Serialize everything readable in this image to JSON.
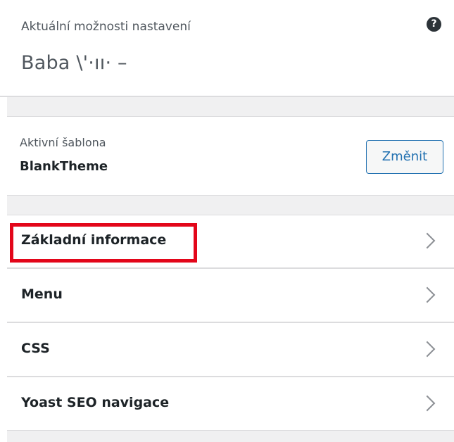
{
  "header": {
    "sublabel": "Aktuální možnosti nastavení",
    "site_title": "Baba \\'·ıı· –",
    "help_icon": "help-icon",
    "help_glyph": "?"
  },
  "theme": {
    "label": "Aktivní šablona",
    "name": "BlankTheme",
    "change_label": "Změnit"
  },
  "nav": {
    "items": [
      {
        "label": "Základní informace",
        "highlighted": true
      },
      {
        "label": "Menu",
        "highlighted": false
      },
      {
        "label": "CSS",
        "highlighted": false
      },
      {
        "label": "Yoast SEO navigace",
        "highlighted": false
      }
    ],
    "chevron_icon": "chevron-right-icon"
  },
  "colors": {
    "highlight": "#e3061a",
    "accent": "#2271b1",
    "section_gap": "#f0f0f1"
  }
}
